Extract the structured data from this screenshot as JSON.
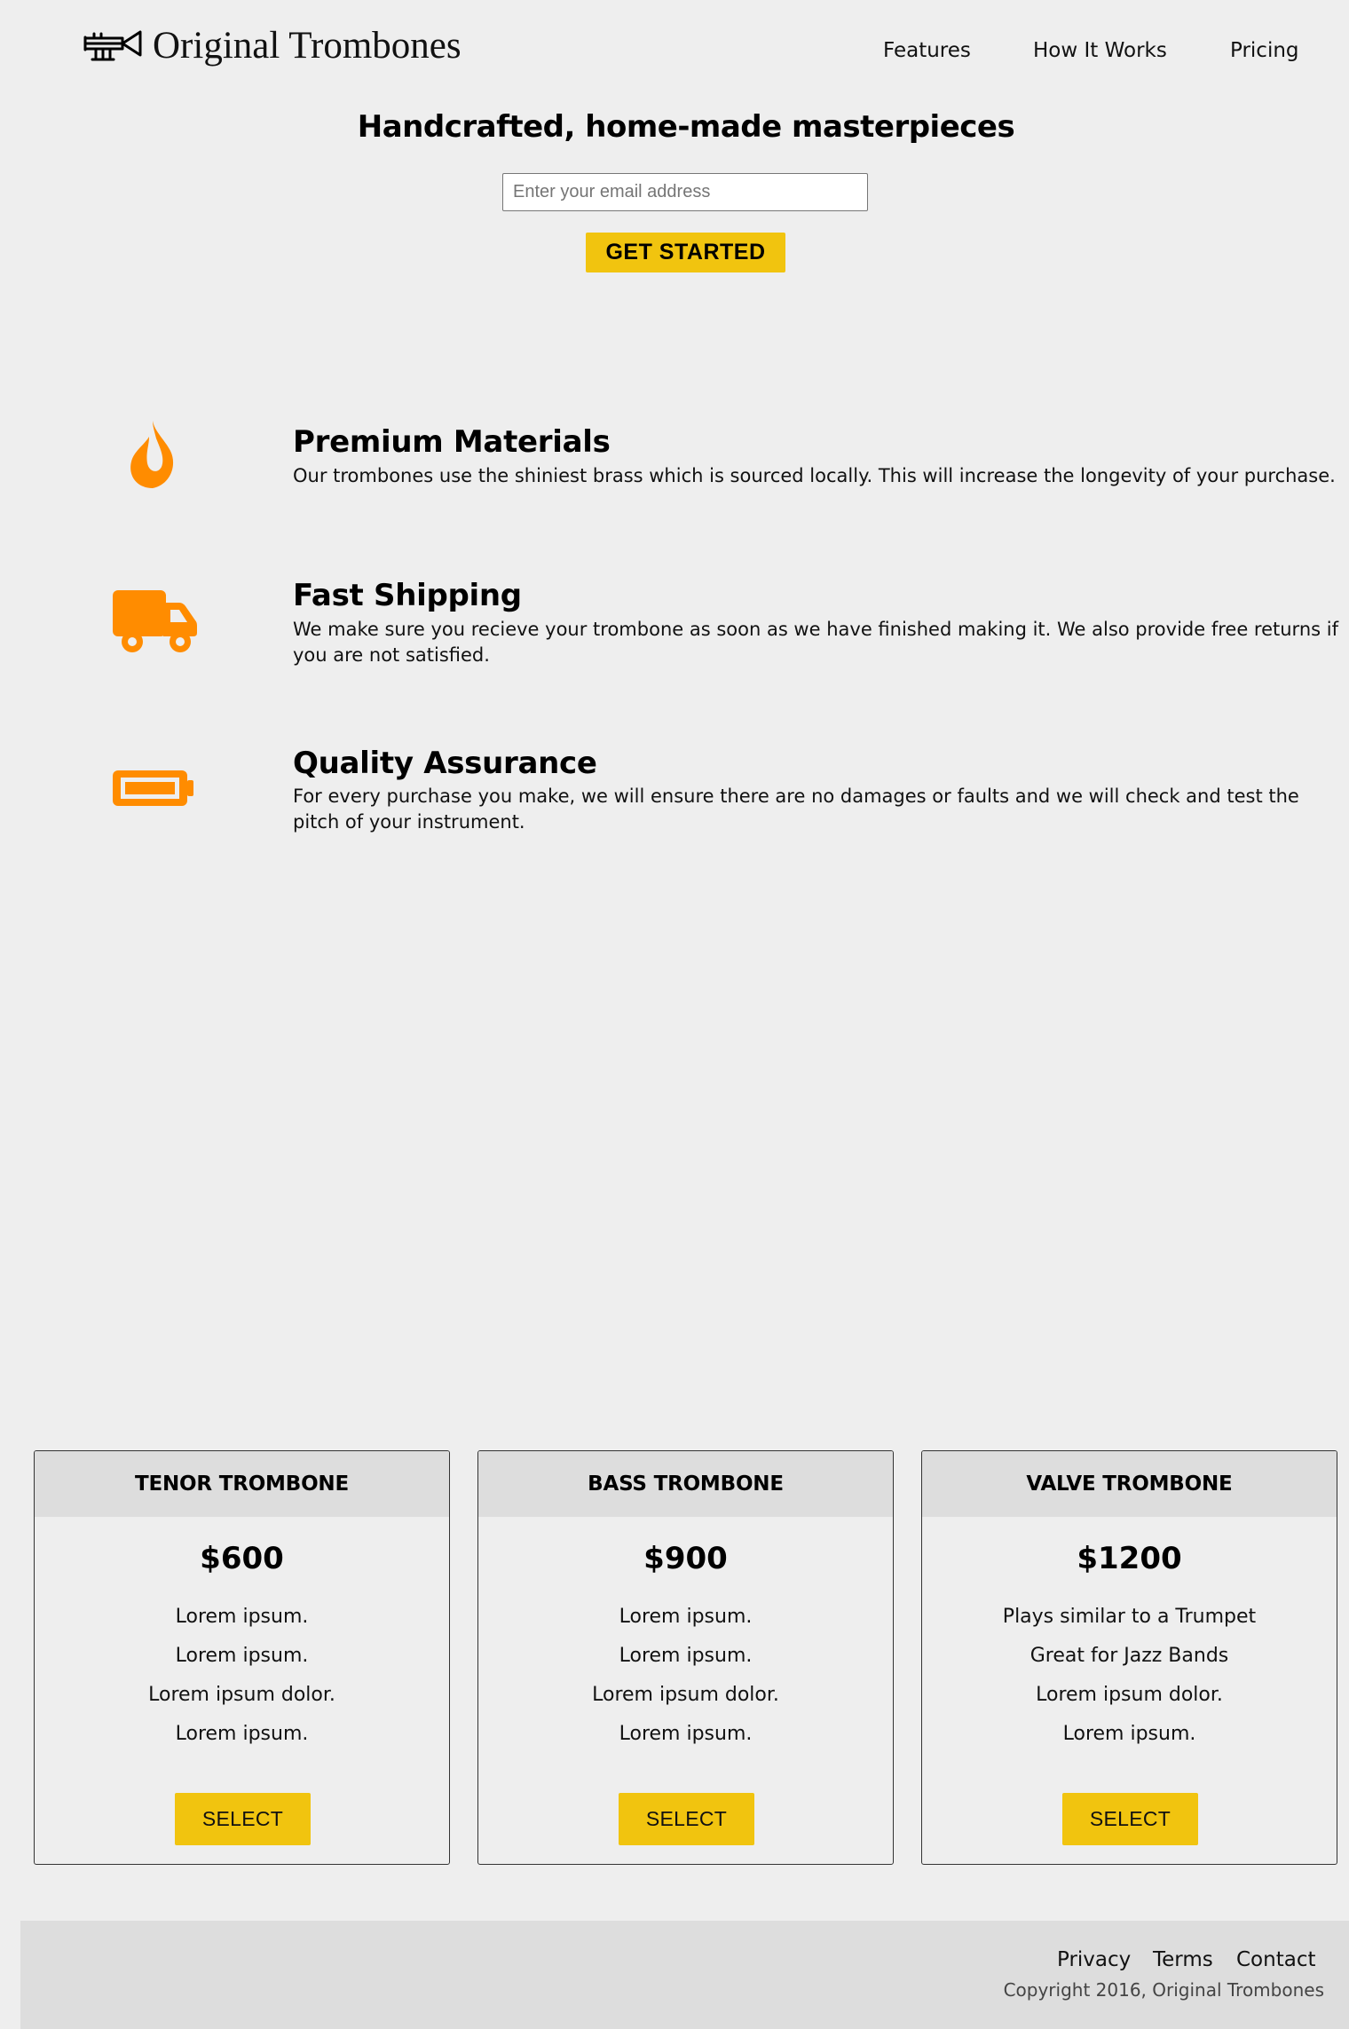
{
  "header": {
    "brand": "Original Trombones",
    "nav": [
      {
        "label": "Features"
      },
      {
        "label": "How It Works"
      },
      {
        "label": "Pricing"
      }
    ]
  },
  "hero": {
    "title": "Handcrafted, home-made masterpieces",
    "email_placeholder": "Enter your email address",
    "cta_label": "GET STARTED"
  },
  "features": [
    {
      "icon": "fire-icon",
      "title": "Premium Materials",
      "text": "Our trombones use the shiniest brass which is sourced locally. This will increase the longevity of your purchase."
    },
    {
      "icon": "truck-icon",
      "title": "Fast Shipping",
      "text": "We make sure you recieve your trombone as soon as we have finished making it. We also provide free returns if you are not satisfied."
    },
    {
      "icon": "battery-icon",
      "title": "Quality Assurance",
      "text": "For every purchase you make, we will ensure there are no damages or faults and we will check and test the pitch of your instrument."
    }
  ],
  "pricing": [
    {
      "name": "TENOR TROMBONE",
      "price": "$600",
      "features": [
        "Lorem ipsum.",
        "Lorem ipsum.",
        "Lorem ipsum dolor.",
        "Lorem ipsum."
      ],
      "button": "SELECT"
    },
    {
      "name": "BASS TROMBONE",
      "price": "$900",
      "features": [
        "Lorem ipsum.",
        "Lorem ipsum.",
        "Lorem ipsum dolor.",
        "Lorem ipsum."
      ],
      "button": "SELECT"
    },
    {
      "name": "VALVE TROMBONE",
      "price": "$1200",
      "features": [
        "Plays similar to a Trumpet",
        "Great for Jazz Bands",
        "Lorem ipsum dolor.",
        "Lorem ipsum."
      ],
      "button": "SELECT"
    }
  ],
  "footer": {
    "links": [
      {
        "label": "Privacy"
      },
      {
        "label": "Terms"
      },
      {
        "label": "Contact"
      }
    ],
    "copyright": "Copyright 2016, Original Trombones"
  },
  "colors": {
    "background": "#eeeeee",
    "accent": "#f1c40f",
    "icon": "#ff8c00",
    "panel": "#dddddd"
  }
}
